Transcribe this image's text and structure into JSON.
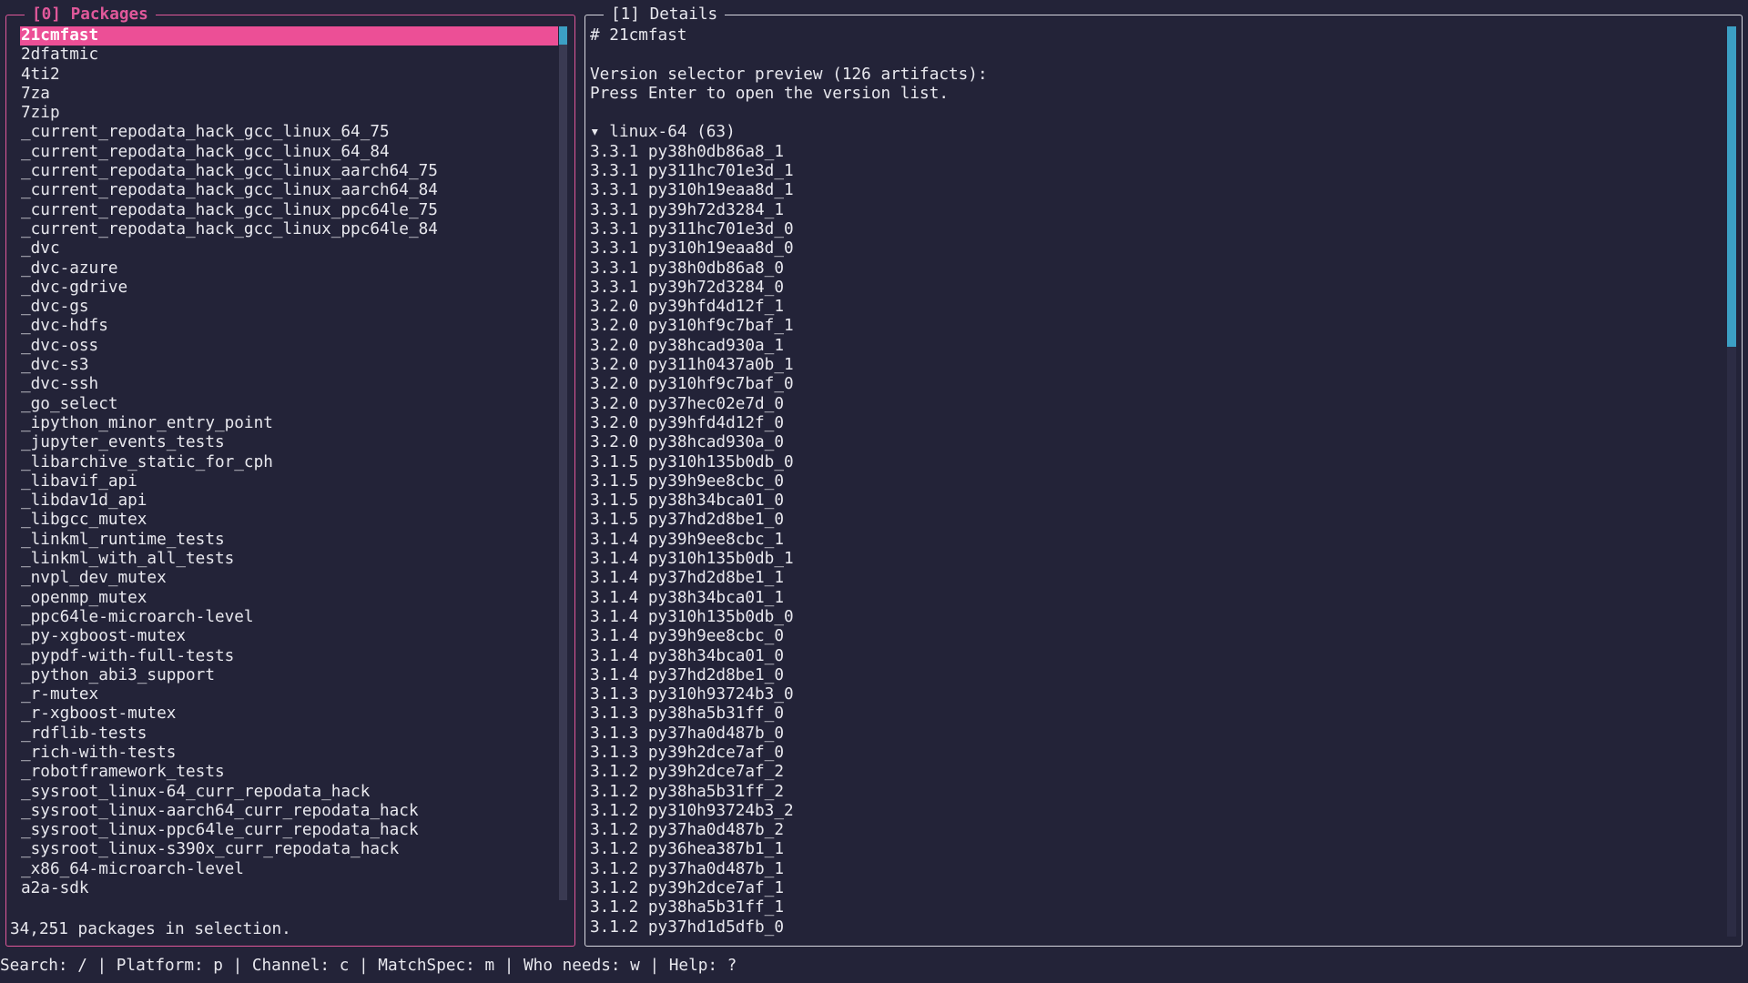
{
  "packages_panel": {
    "title": "[0] Packages",
    "items": [
      "21cmfast",
      "2dfatmic",
      "4ti2",
      "7za",
      "7zip",
      "_current_repodata_hack_gcc_linux_64_75",
      "_current_repodata_hack_gcc_linux_64_84",
      "_current_repodata_hack_gcc_linux_aarch64_75",
      "_current_repodata_hack_gcc_linux_aarch64_84",
      "_current_repodata_hack_gcc_linux_ppc64le_75",
      "_current_repodata_hack_gcc_linux_ppc64le_84",
      "_dvc",
      "_dvc-azure",
      "_dvc-gdrive",
      "_dvc-gs",
      "_dvc-hdfs",
      "_dvc-oss",
      "_dvc-s3",
      "_dvc-ssh",
      "_go_select",
      "_ipython_minor_entry_point",
      "_jupyter_events_tests",
      "_libarchive_static_for_cph",
      "_libavif_api",
      "_libdav1d_api",
      "_libgcc_mutex",
      "_linkml_runtime_tests",
      "_linkml_with_all_tests",
      "_nvpl_dev_mutex",
      "_openmp_mutex",
      "_ppc64le-microarch-level",
      "_py-xgboost-mutex",
      "_pypdf-with-full-tests",
      "_python_abi3_support",
      "_r-mutex",
      "_r-xgboost-mutex",
      "_rdflib-tests",
      "_rich-with-tests",
      "_robotframework_tests",
      "_sysroot_linux-64_curr_repodata_hack",
      "_sysroot_linux-aarch64_curr_repodata_hack",
      "_sysroot_linux-ppc64le_curr_repodata_hack",
      "_sysroot_linux-s390x_curr_repodata_hack",
      "_x86_64-microarch-level",
      "a2a-sdk"
    ],
    "selected_index": 0,
    "status": "34,251 packages in selection."
  },
  "details_panel": {
    "title": "[1] Details",
    "heading": "# 21cmfast",
    "preview_line": "Version selector preview (126 artifacts):",
    "hint_line": "Press Enter to open the version list.",
    "group_header": "▾ linux-64 (63)",
    "versions": [
      "3.3.1 py38h0db86a8_1",
      "3.3.1 py311hc701e3d_1",
      "3.3.1 py310h19eaa8d_1",
      "3.3.1 py39h72d3284_1",
      "3.3.1 py311hc701e3d_0",
      "3.3.1 py310h19eaa8d_0",
      "3.3.1 py38h0db86a8_0",
      "3.3.1 py39h72d3284_0",
      "3.2.0 py39hfd4d12f_1",
      "3.2.0 py310hf9c7baf_1",
      "3.2.0 py38hcad930a_1",
      "3.2.0 py311h0437a0b_1",
      "3.2.0 py310hf9c7baf_0",
      "3.2.0 py37hec02e7d_0",
      "3.2.0 py39hfd4d12f_0",
      "3.2.0 py38hcad930a_0",
      "3.1.5 py310h135b0db_0",
      "3.1.5 py39h9ee8cbc_0",
      "3.1.5 py38h34bca01_0",
      "3.1.5 py37hd2d8be1_0",
      "3.1.4 py39h9ee8cbc_1",
      "3.1.4 py310h135b0db_1",
      "3.1.4 py37hd2d8be1_1",
      "3.1.4 py38h34bca01_1",
      "3.1.4 py310h135b0db_0",
      "3.1.4 py39h9ee8cbc_0",
      "3.1.4 py38h34bca01_0",
      "3.1.4 py37hd2d8be1_0",
      "3.1.3 py310h93724b3_0",
      "3.1.3 py38ha5b31ff_0",
      "3.1.3 py37ha0d487b_0",
      "3.1.3 py39h2dce7af_0",
      "3.1.2 py39h2dce7af_2",
      "3.1.2 py38ha5b31ff_2",
      "3.1.2 py310h93724b3_2",
      "3.1.2 py37ha0d487b_2",
      "3.1.2 py36hea387b1_1",
      "3.1.2 py37ha0d487b_1",
      "3.1.2 py39h2dce7af_1",
      "3.1.2 py38ha5b31ff_1",
      "3.1.2 py37hd1d5dfb_0"
    ]
  },
  "footer": {
    "text": "Search: / | Platform: p | Channel: c | MatchSpec: m | Who needs: w | Help: ?"
  }
}
